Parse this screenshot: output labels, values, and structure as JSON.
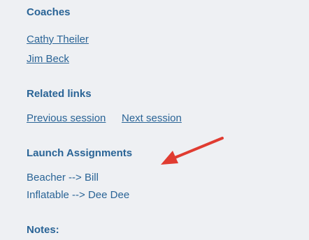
{
  "coaches": {
    "title": "Coaches",
    "items": [
      "Cathy Theiler",
      "Jim Beck"
    ]
  },
  "related_links": {
    "title": "Related links",
    "previous": "Previous session",
    "next": "Next session"
  },
  "launch_assignments": {
    "title": "Launch Assignments",
    "items": [
      "Beacher --> Bill",
      "Inflatable --> Dee Dee"
    ]
  },
  "notes": {
    "title": "Notes:"
  },
  "colors": {
    "link": "#2a6496",
    "background": "#eef0f3",
    "annotation_arrow": "#e03c31"
  },
  "annotation": {
    "icon": "red-arrow-icon"
  }
}
